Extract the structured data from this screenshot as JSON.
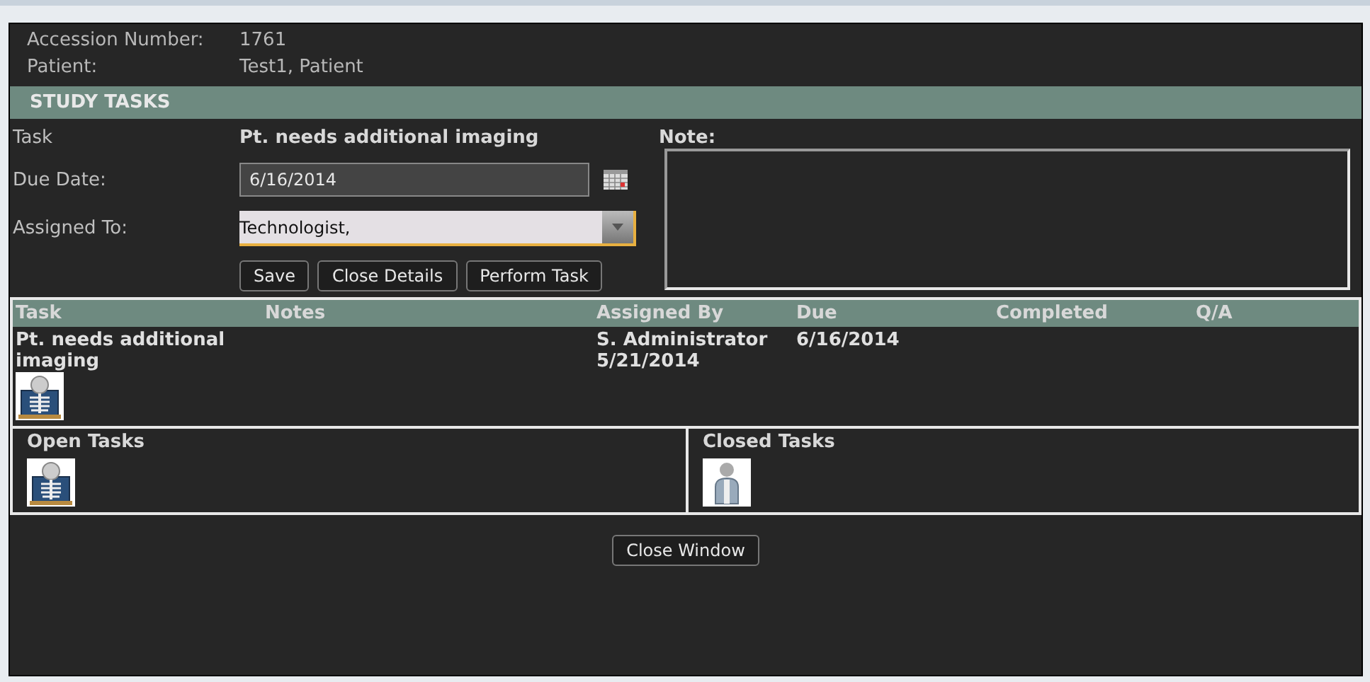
{
  "header": {
    "fields": [
      {
        "label": "Accession Number:",
        "value": "1761"
      },
      {
        "label": "Patient:",
        "value": "Test1, Patient"
      }
    ]
  },
  "section_title": "STUDY TASKS",
  "form": {
    "task_label": "Task",
    "task_value": "Pt. needs additional imaging",
    "due_label": "Due Date:",
    "due_value": "6/16/2014",
    "assigned_label": "Assigned To:",
    "assigned_value": "Technologist,",
    "note_label": "Note:",
    "buttons": [
      "Save",
      "Close Details",
      "Perform Task"
    ]
  },
  "table": {
    "columns": [
      "Task",
      "Notes",
      "Assigned By",
      "Due",
      "Completed",
      "Q/A"
    ],
    "rows": [
      {
        "task": "Pt. needs additional imaging",
        "kind": "xray",
        "assigned_by": "S. Administrator",
        "assigned_date": "5/21/2014",
        "due": "6/16/2014"
      }
    ]
  },
  "task_lists": [
    {
      "title": "Open Tasks",
      "kind": "xray"
    },
    {
      "title": "Closed Tasks",
      "kind": "person"
    }
  ],
  "close_button": "Close Window"
}
